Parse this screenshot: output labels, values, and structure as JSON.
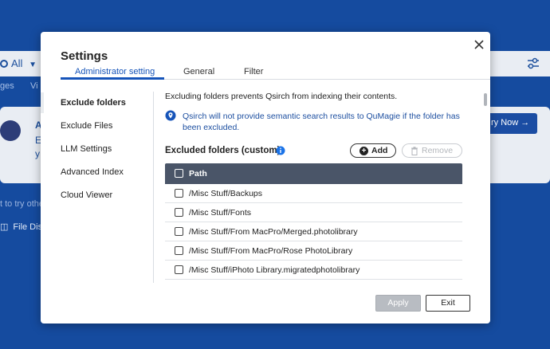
{
  "background": {
    "search_scope": "All",
    "tabs": [
      "ges",
      "Vi"
    ],
    "card_text_initial": "A",
    "card_line_2": "E",
    "card_line_3": "y",
    "try_button": "ry Now →",
    "hint": "t to try othe",
    "file_dist": "File Distr"
  },
  "modal": {
    "title": "Settings",
    "close_icon": "close-icon",
    "tabs": [
      {
        "label": "Administrator setting",
        "active": true
      },
      {
        "label": "General",
        "active": false
      },
      {
        "label": "Filter",
        "active": false
      }
    ],
    "side_nav": [
      {
        "label": "Exclude folders",
        "active": true
      },
      {
        "label": "Exclude Files",
        "active": false
      },
      {
        "label": "LLM Settings",
        "active": false
      },
      {
        "label": "Advanced Index",
        "active": false
      },
      {
        "label": "Cloud Viewer",
        "active": false
      }
    ],
    "content": {
      "description": "Excluding folders prevents Qsirch from indexing their contents.",
      "info_text": "Qsirch will not provide semantic search results to QuMagie if the folder has been excluded.",
      "section_title": "Excluded folders (custom)",
      "add_label": "Add",
      "remove_label": "Remove",
      "table": {
        "header": "Path",
        "rows": [
          "/Misc Stuff/Backups",
          "/Misc Stuff/Fonts",
          "/Misc Stuff/From MacPro/Merged.photolibrary",
          "/Misc Stuff/From MacPro/Rose PhotoLibrary",
          "/Misc Stuff/iPhoto Library.migratedphotolibrary"
        ]
      }
    },
    "footer": {
      "apply_label": "Apply",
      "exit_label": "Exit"
    }
  },
  "colors": {
    "page_bg": "#154b9f",
    "accent": "#1654b9",
    "table_header": "#4a5568",
    "info_text": "#1d4fa0"
  }
}
